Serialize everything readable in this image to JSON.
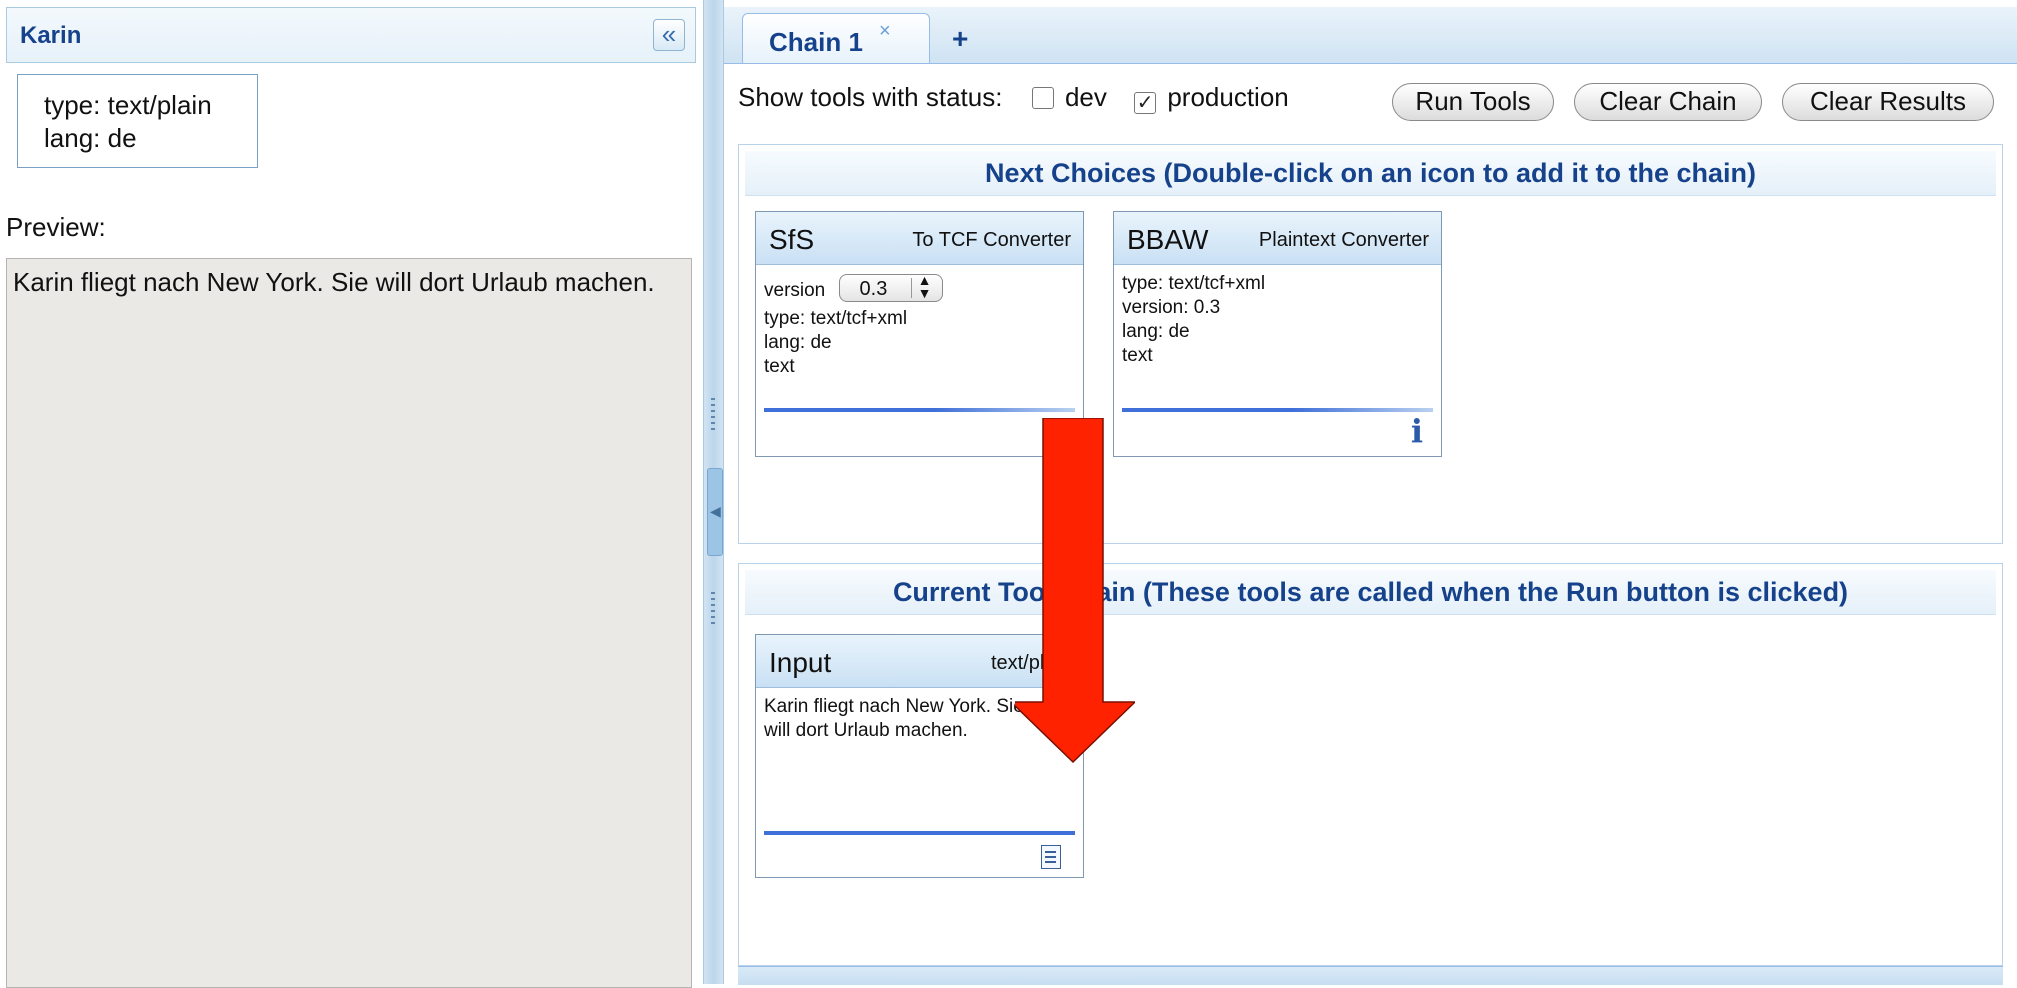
{
  "left": {
    "title": "Karin",
    "meta_lines": [
      "type: text/plain",
      "lang: de"
    ],
    "preview_label": "Preview:",
    "preview_text": "Karin fliegt nach New York. Sie will dort Urlaub machen."
  },
  "tabs": [
    {
      "label": "Chain 1",
      "close": "×"
    }
  ],
  "tab_add": "+",
  "toolbar": {
    "status_label": "Show tools with status:",
    "dev_label": "dev",
    "dev_checked": false,
    "production_label": "production",
    "production_checked": true,
    "run_tools": "Run Tools",
    "clear_chain": "Clear Chain",
    "clear_results": "Clear Results"
  },
  "next_choices": {
    "title": "Next Choices (Double-click on an icon to add it to the chain)",
    "tools": [
      {
        "name": "SfS",
        "type": "To TCF Converter",
        "version_label": "version",
        "version_value": "0.3",
        "lines": [
          "type: text/tcf+xml",
          "lang: de",
          "text"
        ]
      },
      {
        "name": "BBAW",
        "type": "Plaintext Converter",
        "lines": [
          "type: text/tcf+xml",
          "version: 0.3",
          "lang: de",
          "text"
        ],
        "icon": "info-icon"
      }
    ]
  },
  "current_chain": {
    "title": "Current Tool Chain (These tools are called when the Run button is clicked)",
    "tools": [
      {
        "name": "Input",
        "type": "text/plain",
        "lines": [
          "Karin fliegt nach New York. Sie",
          "will dort Urlaub machen."
        ],
        "icon": "document-icon"
      }
    ]
  },
  "colors": {
    "accent": "#15428b",
    "overlay_arrow": "#ff2200"
  }
}
